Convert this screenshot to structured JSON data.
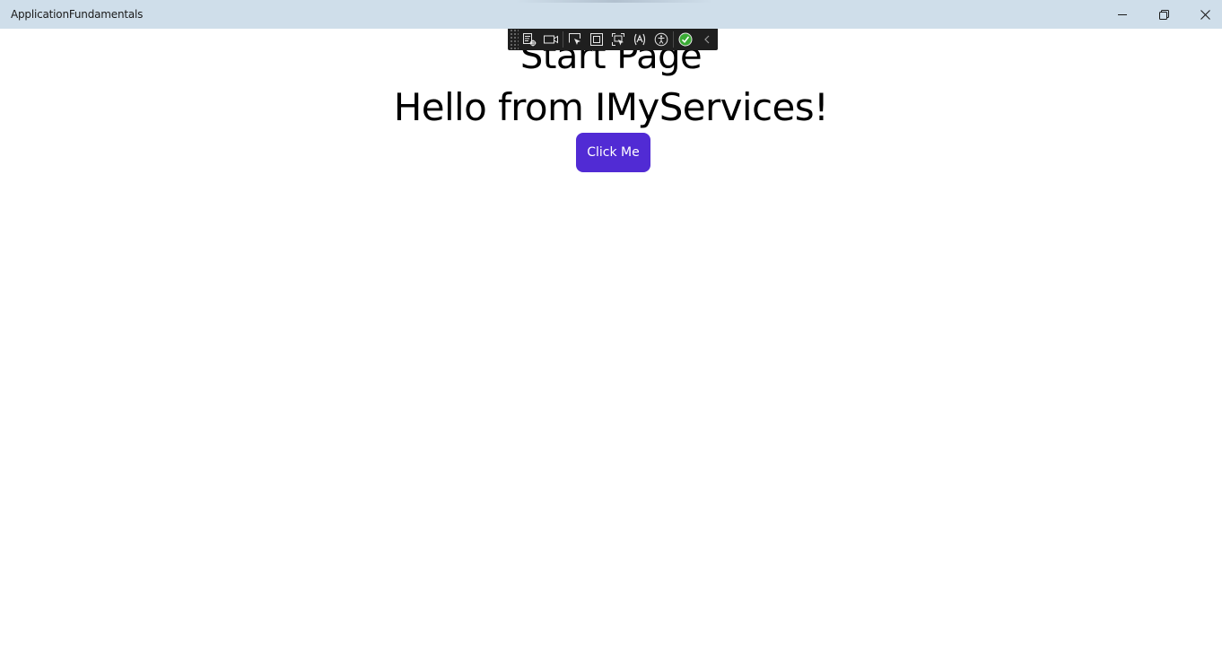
{
  "window": {
    "title": "ApplicationFundamentals",
    "controls": {
      "minimize": "minimize-icon",
      "maximize": "restore-icon",
      "close": "close-icon"
    }
  },
  "page": {
    "title": "Start Page",
    "message": "Hello from IMyServices!",
    "button_label": "Click Me"
  },
  "dev_toolbar": {
    "icons": [
      "live-visual-tree-icon",
      "record-icon",
      "select-element-icon",
      "display-layout-adorners-icon",
      "track-focus-icon",
      "binding-failures-icon",
      "accessibility-icon",
      "hot-reload-status-icon",
      "collapse-toolbar-icon"
    ]
  },
  "colors": {
    "titlebar": "#cfdeea",
    "button": "#512bd4",
    "button_text": "#ffffff",
    "toolbar": "#1f1f1f",
    "status_ok": "#3aaa35"
  }
}
